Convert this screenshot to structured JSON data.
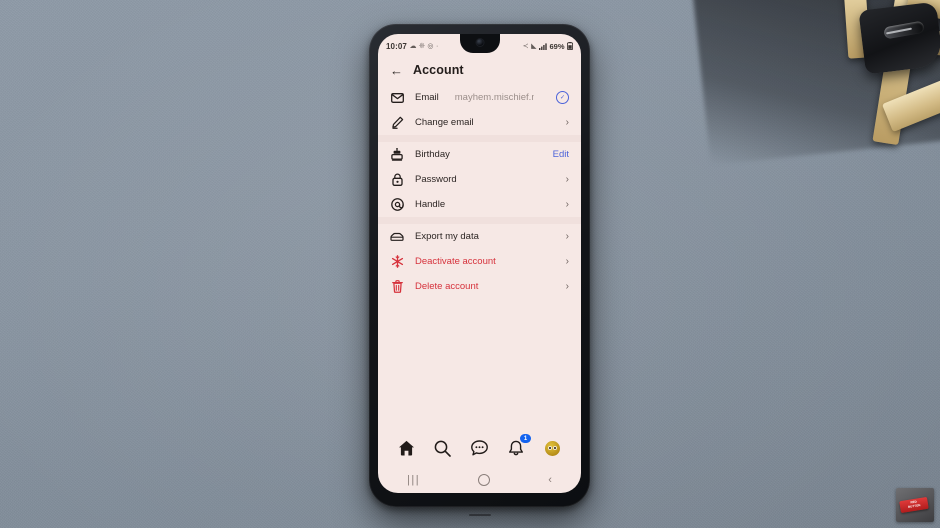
{
  "scene": {
    "surface": "gray-blue textured desk mat",
    "surface_color": "#8b97a4",
    "props": [
      "wooden craft sticks",
      "black clamp"
    ]
  },
  "watermark": {
    "line1": "RED",
    "line2": "BUTTON"
  },
  "phone": {
    "status_bar": {
      "time": "10:07",
      "left_icons": [
        "cloud-icon",
        "photos-icon",
        "app-icon",
        "dot-icon"
      ],
      "right_icons": [
        "share-icon",
        "wifi-icon",
        "signal-icon"
      ],
      "battery_percent": "69%",
      "battery_icon": "battery-icon"
    },
    "app_bar": {
      "back_icon": "←",
      "title": "Account"
    },
    "groups": [
      {
        "rows": [
          {
            "icon": "envelope-icon",
            "label": "Email",
            "value": "mayhem.mischief.mm@...",
            "trailing": "verified-icon",
            "danger": false
          },
          {
            "icon": "pencil-icon",
            "label": "Change email",
            "value": "",
            "trailing": "chevron",
            "danger": false
          }
        ]
      },
      {
        "rows": [
          {
            "icon": "birthday-cake-icon",
            "label": "Birthday",
            "value": "",
            "trailing": "edit-link",
            "edit_label": "Edit",
            "danger": false
          },
          {
            "icon": "lock-icon",
            "label": "Password",
            "value": "",
            "trailing": "chevron",
            "danger": false
          },
          {
            "icon": "at-sign-icon",
            "label": "Handle",
            "value": "",
            "trailing": "chevron",
            "danger": false
          }
        ]
      },
      {
        "rows": [
          {
            "icon": "export-icon",
            "label": "Export my data",
            "value": "",
            "trailing": "chevron",
            "danger": false
          },
          {
            "icon": "snowflake-icon",
            "label": "Deactivate account",
            "value": "",
            "trailing": "chevron",
            "danger": true
          },
          {
            "icon": "trash-icon",
            "label": "Delete account",
            "value": "",
            "trailing": "chevron",
            "danger": true
          }
        ]
      }
    ],
    "bottom_nav": [
      {
        "name": "home",
        "icon": "home-icon",
        "badge": ""
      },
      {
        "name": "search",
        "icon": "search-icon",
        "badge": ""
      },
      {
        "name": "messages",
        "icon": "chat-bubble-icon",
        "badge": ""
      },
      {
        "name": "notifications",
        "icon": "bell-icon",
        "badge": "1"
      },
      {
        "name": "profile",
        "icon": "avatar-icon",
        "badge": ""
      }
    ],
    "system_bar": {
      "recents": "|||",
      "home": "○",
      "back": "‹"
    }
  },
  "colors": {
    "screen_bg": "#f6e8e5",
    "accent_link": "#4c63d9",
    "danger": "#d6323c",
    "badge": "#1463ef",
    "text": "#2d2624",
    "muted": "#9b8e8a"
  }
}
